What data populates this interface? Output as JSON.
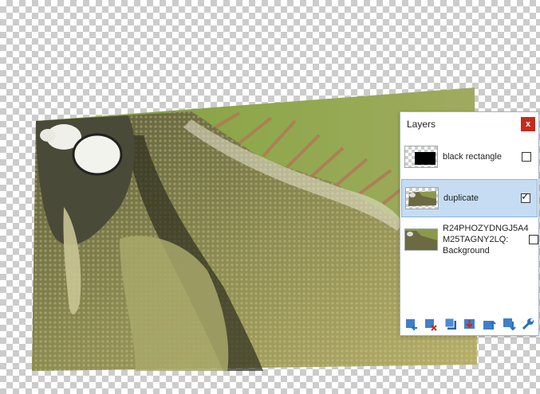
{
  "colors": {
    "accent": "#2b6fbf",
    "close": "#c42b1c",
    "selected_row": "#c6dcf3"
  },
  "layers_panel": {
    "title": "Layers",
    "close_label": "x",
    "layers": [
      {
        "name": "black rectangle",
        "visible": false,
        "selected": false
      },
      {
        "name": "duplicate",
        "visible": true,
        "selected": true
      },
      {
        "name": "R24PHOZYDNGJ5A4 M25TAGNY2LQ: Background",
        "visible": false,
        "selected": false
      }
    ],
    "toolbar": [
      {
        "icon": "add-layer-icon"
      },
      {
        "icon": "delete-layer-icon"
      },
      {
        "icon": "duplicate-layer-icon"
      },
      {
        "icon": "merge-down-icon"
      },
      {
        "icon": "move-layer-up-icon"
      },
      {
        "icon": "move-layer-down-icon"
      },
      {
        "icon": "layer-properties-icon"
      }
    ]
  }
}
